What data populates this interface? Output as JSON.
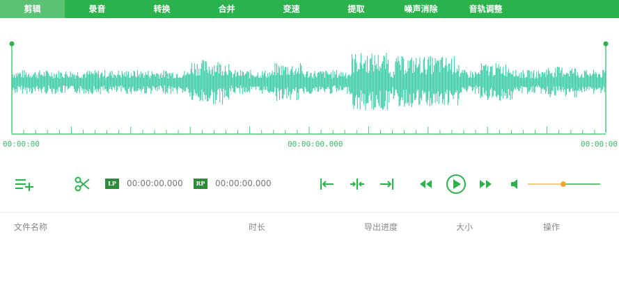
{
  "tabs": [
    {
      "label": "剪辑",
      "active": true
    },
    {
      "label": "录音",
      "active": false
    },
    {
      "label": "转换",
      "active": false
    },
    {
      "label": "合并",
      "active": false
    },
    {
      "label": "变速",
      "active": false
    },
    {
      "label": "提取",
      "active": false
    },
    {
      "label": "噪声消除",
      "active": false
    },
    {
      "label": "音轨调整",
      "active": false
    }
  ],
  "timeline": {
    "start": "00:00:00",
    "middle": "00:00:00.000",
    "end": "00:00:00"
  },
  "markers": {
    "lp_label": "LP",
    "lp_time": "00:00:00.000",
    "rp_label": "RP",
    "rp_time": "00:00:00.000"
  },
  "volume_level": 0.49,
  "table": {
    "columns": [
      "文件名称",
      "时长",
      "导出进度",
      "大小",
      "操作"
    ]
  },
  "colors": {
    "accent": "#2bb24c",
    "waveform": "#3ecca6",
    "timeline": "#4cc97a",
    "slider_track": "#f5c882",
    "slider_thumb": "#f2a63a"
  },
  "icons": [
    "add-list-icon",
    "scissors-icon",
    "align-start-icon",
    "align-center-icon",
    "align-end-icon",
    "rewind-icon",
    "play-icon",
    "fast-forward-icon",
    "volume-icon"
  ]
}
